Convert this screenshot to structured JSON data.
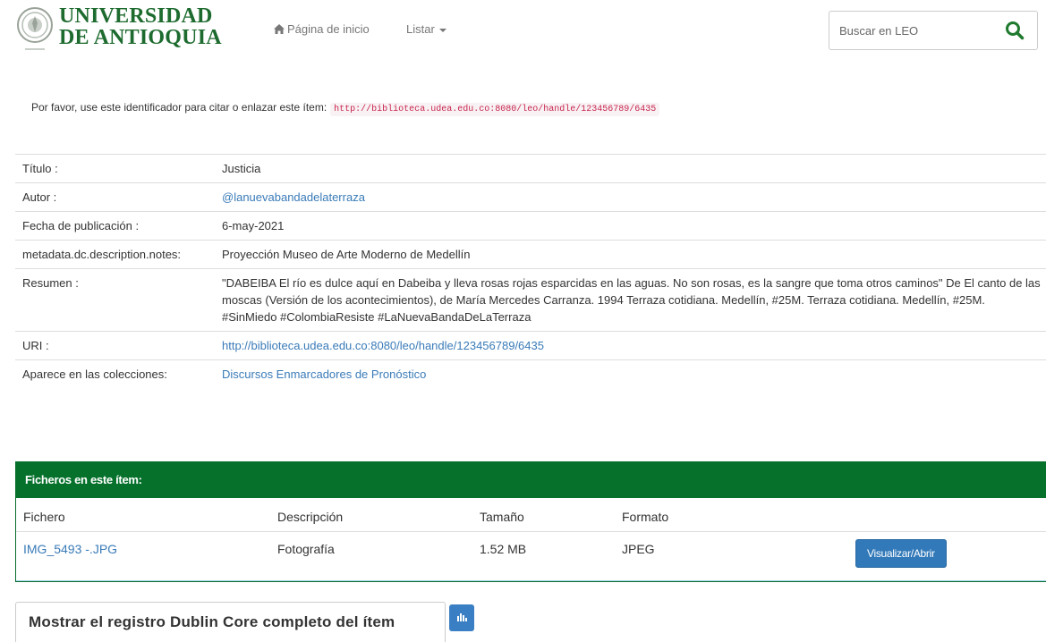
{
  "header": {
    "logo_line1": "UNIVERSIDAD",
    "logo_line2": "DE ANTIOQUIA",
    "nav_home": "Página de inicio",
    "nav_listar": "Listar",
    "search_placeholder": "Buscar en LEO"
  },
  "cite": {
    "text": "Por favor, use este identificador para citar o enlazar este ítem:",
    "url": "http://biblioteca.udea.edu.co:8080/leo/handle/123456789/6435"
  },
  "metadata": [
    {
      "label": "Título :",
      "value": "Justicia"
    },
    {
      "label": "Autor :",
      "value": "@lanuevabandadelaterraza"
    },
    {
      "label": "Fecha de publicación :",
      "value": "6-may-2021"
    },
    {
      "label": "metadata.dc.description.notes:",
      "value": "Proyección Museo de Arte Moderno de Medellín"
    },
    {
      "label": "Resumen :",
      "value": "\"DABEIBA El río es dulce aquí en Dabeiba y lleva rosas rojas esparcidas en las aguas. No son rosas, es la sangre que toma otros caminos\" De El canto de las moscas (Versión de los acontecimientos), de María Mercedes Carranza. 1994 Terraza cotidiana. Medellín, #25M. Terraza cotidiana. Medellín, #25M. #SinMiedo #ColombiaResiste #LaNuevaBandaDeLaTerraza"
    },
    {
      "label": "URI :",
      "value": "http://biblioteca.udea.edu.co:8080/leo/handle/123456789/6435"
    },
    {
      "label": "Aparece en las colecciones:",
      "value": "Discursos Enmarcadores de Pronóstico"
    }
  ],
  "files": {
    "title": "Ficheros en este ítem:",
    "columns": [
      "Fichero",
      "Descripción",
      "Tamaño",
      "Formato"
    ],
    "rows": [
      {
        "name": "IMG_5493 -.JPG",
        "description": "Fotografía",
        "size": "1.52 MB",
        "format": "JPEG",
        "button": "Visualizar/Abrir"
      }
    ]
  },
  "bottom": {
    "dc_label": "Mostrar el registro Dublin Core completo del ítem"
  },
  "colors": {
    "brand_green": "#05712b",
    "link_blue": "#3a7bb8",
    "button_blue": "#3279b9"
  }
}
